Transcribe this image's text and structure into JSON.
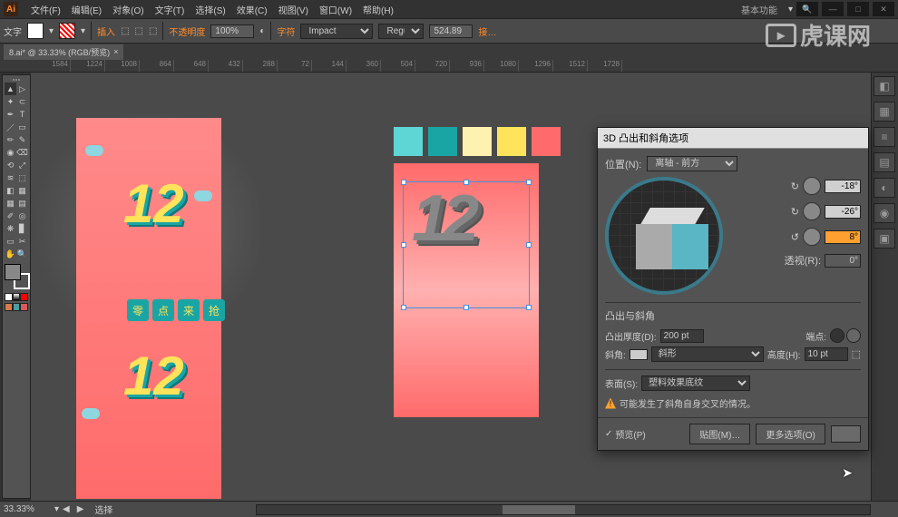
{
  "app": {
    "icon": "Ai"
  },
  "menu": [
    "文件(F)",
    "编辑(E)",
    "对象(O)",
    "文字(T)",
    "选择(S)",
    "效果(C)",
    "视图(V)",
    "窗口(W)",
    "帮助(H)"
  ],
  "workspace": "基本功能",
  "ctrl": {
    "type_label": "文字",
    "anchor_label": "插入",
    "opacity_label": "不透明度",
    "opacity_value": "100%",
    "char_label": "字符",
    "font": "Impact",
    "style": "Regu…",
    "size": "524.89",
    "align_label": "接…"
  },
  "doc_tab": "8.ai* @ 33.33% (RGB/预览)",
  "ruler": [
    "1584",
    "1224",
    "1008",
    "864",
    "648",
    "432",
    "288",
    "72",
    "144",
    "360",
    "504",
    "720",
    "936",
    "1080",
    "1296",
    "1512",
    "1728"
  ],
  "palette_colors": [
    "#5ed6d6",
    "#1aa5a5",
    "#fff2b0",
    "#ffe35a",
    "#ff6b6b"
  ],
  "ref_banner": [
    "零",
    "点",
    "来",
    "抢"
  ],
  "ref_glyph": "12",
  "center_glyph": "12",
  "dialog": {
    "title": "3D 凸出和斜角选项",
    "position_label": "位置(N):",
    "position_value": "离轴 - 前方",
    "angle_x": "-18°",
    "angle_y": "-26°",
    "angle_z": "8°",
    "perspective_label": "透视(R):",
    "perspective_value": "0°",
    "extrude_section": "凸出与斜角",
    "depth_label": "凸出厚度(D):",
    "depth_value": "200 pt",
    "cap_label": "端点:",
    "bevel_label": "斜角:",
    "bevel_value": "斜形",
    "height_label": "高度(H):",
    "height_value": "10 pt",
    "surface_label": "表面(S):",
    "surface_value": "塑料效果底纹",
    "warning": "可能发生了斜角自身交叉的情况。",
    "preview_label": "预览(P)",
    "map_btn": "贴图(M)…",
    "more_btn": "更多选项(O)"
  },
  "status": {
    "zoom": "33.33%",
    "tool": "选择"
  },
  "watermark": "虎课网"
}
